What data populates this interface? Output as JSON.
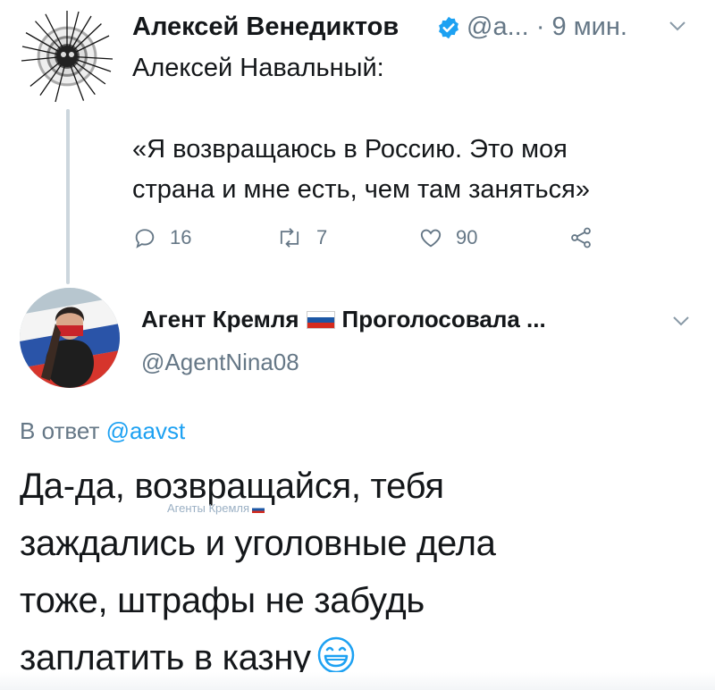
{
  "tweet": {
    "author_name": "Алексей Венедиктов",
    "author_handle": "@а...",
    "time": "· 9 мин.",
    "intro": "Алексей Навальный:",
    "quote_lines": [
      "«Я возвращаюсь в Россию. Это моя",
      "страна и мне есть, чем там заняться»"
    ],
    "replies": "16",
    "retweets": "7",
    "likes": "90"
  },
  "reply": {
    "author_name_part1": "Агент Кремля",
    "author_name_part2": "Проголосовала ...",
    "author_handle": "@AgentNina08",
    "replying_prefix": "В ответ",
    "replying_to": "@aavst",
    "body_lines": [
      "Да-да, возвращайся, тебя",
      "заждались и уголовные дела",
      "тоже, штрафы не забудь",
      "заплатить в казну"
    ]
  },
  "watermark": "Агенты Кремля",
  "icons": {
    "verified": "verified-badge-icon",
    "reply": "reply-icon",
    "retweet": "retweet-icon",
    "like": "heart-icon",
    "share": "share-icon",
    "chevron": "chevron-down-icon",
    "emoji": "grinning-face-icon"
  },
  "colors": {
    "verified_blue": "#1da1f2",
    "muted_text": "#657786",
    "mention_blue": "#1da1f2",
    "thread_line": "#ccd6dd"
  }
}
